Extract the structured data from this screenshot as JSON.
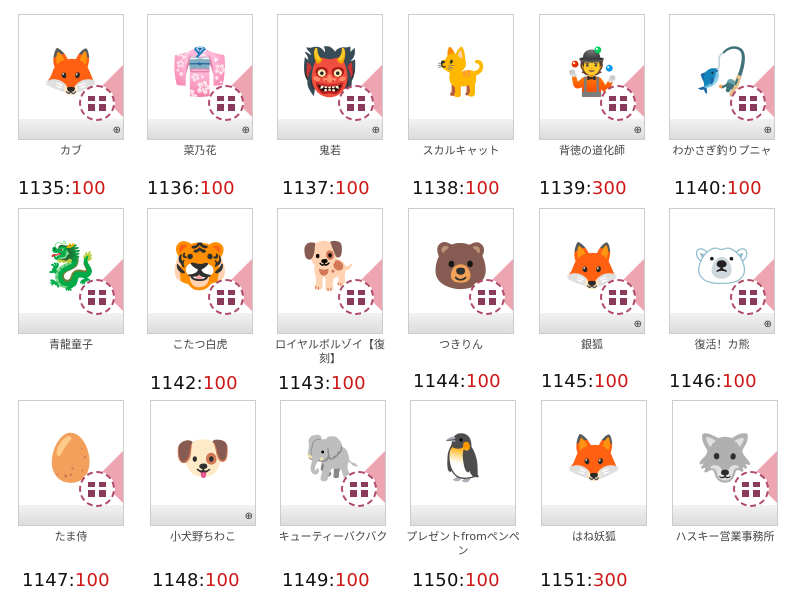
{
  "items": [
    {
      "name": "カブ",
      "id": "1135",
      "value": "100",
      "icon": "yellow-fox-creature",
      "glyph": "🦊",
      "color": "#e8a830"
    },
    {
      "name": "菜乃花",
      "id": "1136",
      "value": "100",
      "icon": "kimono-girl",
      "glyph": "👘",
      "color": "#f0a0c0"
    },
    {
      "name": "鬼若",
      "id": "1137",
      "value": "100",
      "icon": "oni-samurai",
      "glyph": "👹",
      "color": "#604020"
    },
    {
      "name": "スカルキャット",
      "id": "1138",
      "value": "100",
      "icon": "skull-cat",
      "glyph": "🐈",
      "color": "#222222"
    },
    {
      "name": "背徳の道化師",
      "id": "1139",
      "value": "300",
      "icon": "dark-clown",
      "glyph": "🤹",
      "color": "#333333"
    },
    {
      "name": "わかさぎ釣りプニャ",
      "id": "1140",
      "value": "100",
      "icon": "fishing-cat",
      "glyph": "🎣",
      "color": "#d08020"
    },
    {
      "name": "青龍童子",
      "id": "",
      "value": "",
      "icon": "blue-dragon-child",
      "glyph": "🐉",
      "color": "#4080c0"
    },
    {
      "name": "こたつ白虎",
      "id": "1142",
      "value": "100",
      "icon": "kotatsu-white-tiger",
      "glyph": "🐯",
      "color": "#c84020"
    },
    {
      "name": "ロイヤルボルゾイ【復刻】",
      "id": "1143",
      "value": "100",
      "icon": "royal-borzoi",
      "glyph": "🐕",
      "color": "#7a4030"
    },
    {
      "name": "つきりん",
      "id": "1144",
      "value": "100",
      "icon": "moon-bear",
      "glyph": "🐻",
      "color": "#444444"
    },
    {
      "name": "銀狐",
      "id": "1145",
      "value": "100",
      "icon": "silver-fox-girl",
      "glyph": "🦊",
      "color": "#c0c0c0"
    },
    {
      "name": "復活！カ熊",
      "id": "1146",
      "value": "100",
      "icon": "polar-bear",
      "glyph": "🐻‍❄️",
      "color": "#f0f0f0"
    },
    {
      "name": "たま侍",
      "id": "1147",
      "value": "100",
      "icon": "egg-samurai",
      "glyph": "🥚",
      "color": "#f0e0c0"
    },
    {
      "name": "小犬野ちわこ",
      "id": "1148",
      "value": "100",
      "icon": "dog-girl",
      "glyph": "🐶",
      "color": "#c08050"
    },
    {
      "name": "キューティーバクバク",
      "id": "1149",
      "value": "100",
      "icon": "tapir",
      "glyph": "🐘",
      "color": "#303040"
    },
    {
      "name": "プレゼントfromペンペン",
      "id": "1150",
      "value": "100",
      "icon": "penguin-present",
      "glyph": "🐧",
      "color": "#40a0d0"
    },
    {
      "name": "はね妖狐",
      "id": "1151",
      "value": "300",
      "icon": "winged-fox",
      "glyph": "🦊",
      "color": "#e0a040"
    },
    {
      "name": "ハスキー営業事務所",
      "id": "",
      "value": "",
      "icon": "husky",
      "glyph": "🐺",
      "color": "#405070"
    }
  ],
  "separator": ":",
  "zoom_glyph": "⊕"
}
